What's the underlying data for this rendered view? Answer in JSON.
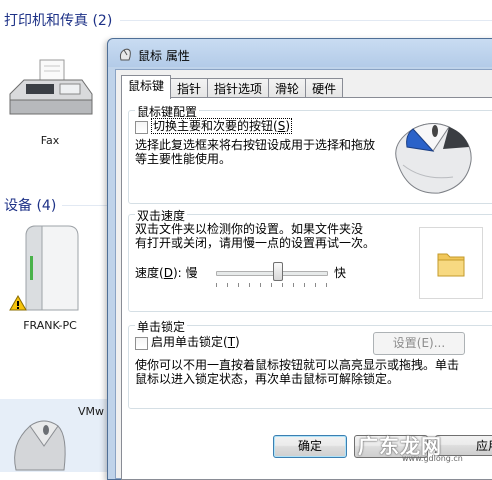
{
  "background": {
    "printers_heading": "打印机和传真 (2)",
    "fax_label": "Fax",
    "devices_heading": "设备 (4)",
    "pc_label": "FRANK-PC",
    "vmw_label": "VMw"
  },
  "dialog": {
    "title": "鼠标 属性",
    "tabs": [
      "鼠标键",
      "指针",
      "指针选项",
      "滑轮",
      "硬件"
    ],
    "button_config": {
      "title": "鼠标键配置",
      "switch_label_pre": "切换主要和次要的按钮(",
      "switch_label_key": "S",
      "switch_label_post": ")",
      "description_line1": "选择此复选框来将右按钮设成用于选择和拖放",
      "description_line2": "等主要性能使用。"
    },
    "double_click": {
      "title": "双击速度",
      "description_line1": "双击文件夹以检测你的设置。如果文件夹没",
      "description_line2": "有打开或关闭，请用慢一点的设置再试一次。",
      "speed_label_pre": "速度(",
      "speed_label_key": "D",
      "speed_label_post": "): 慢",
      "fast_label": "快",
      "speed_value_percent": 55
    },
    "click_lock": {
      "title": "单击锁定",
      "enable_label_pre": "启用单击锁定(",
      "enable_label_key": "T",
      "enable_label_post": ")",
      "settings_button": "设置(E)...",
      "description_line1": "使你可以不用一直按着鼠标按钮就可以高亮显示或拖拽。单击",
      "description_line2": "鼠标以进入锁定状态，再次单击鼠标可解除锁定。"
    },
    "buttons": {
      "ok": "确定",
      "apply_partial": "应用"
    }
  },
  "watermark": {
    "text": "广东龙网",
    "subtext": "www.gdlong.cn"
  }
}
